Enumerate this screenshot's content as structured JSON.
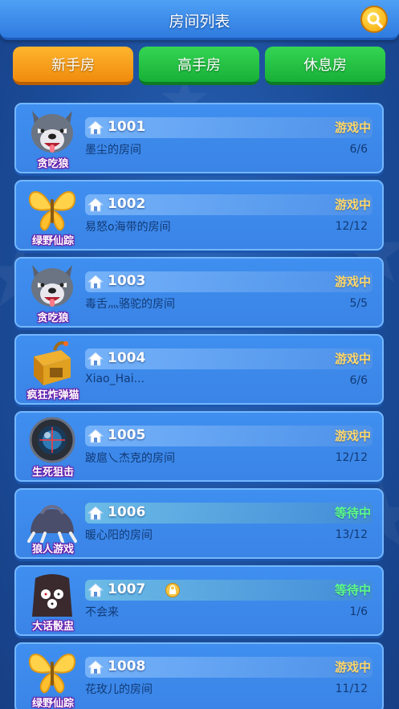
{
  "header": {
    "title": "房间列表"
  },
  "tabs": [
    {
      "label": "新手房",
      "active": true
    },
    {
      "label": "高手房",
      "active": false
    },
    {
      "label": "休息房",
      "active": false
    }
  ],
  "colors": {
    "playing": "#ffd86b",
    "waiting": "#5dfc8a",
    "accent": "#f08b0c"
  },
  "rooms": [
    {
      "id": "1001",
      "game": "贪吃狼",
      "icon": "wolf-icon",
      "name": "墨尘的房间",
      "status": "游戏中",
      "state": "playing",
      "count": "6/6",
      "locked": false
    },
    {
      "id": "1002",
      "game": "绿野仙踪",
      "icon": "butterfly-icon",
      "name": "易怒o海带的房间",
      "status": "游戏中",
      "state": "playing",
      "count": "12/12",
      "locked": false
    },
    {
      "id": "1003",
      "game": "贪吃狼",
      "icon": "wolf-icon",
      "name": "毒舌灬骆驼的房间",
      "status": "游戏中",
      "state": "playing",
      "count": "5/5",
      "locked": false
    },
    {
      "id": "1004",
      "game": "疯狂炸弹猫",
      "icon": "bomb-crate-icon",
      "name": "Xiao_Hai...",
      "status": "游戏中",
      "state": "playing",
      "count": "6/6",
      "locked": false
    },
    {
      "id": "1005",
      "game": "生死狙击",
      "icon": "scope-icon",
      "name": "跛扈乀杰克的房间",
      "status": "游戏中",
      "state": "playing",
      "count": "12/12",
      "locked": false
    },
    {
      "id": "1006",
      "game": "狼人游戏",
      "icon": "wolf-claw-icon",
      "name": "暖心阳的房间",
      "status": "等待中",
      "state": "waiting",
      "count": "13/12",
      "locked": false
    },
    {
      "id": "1007",
      "game": "大话骰盅",
      "icon": "dice-cup-icon",
      "name": "不会来",
      "status": "等待中",
      "state": "waiting",
      "count": "1/6",
      "locked": true
    },
    {
      "id": "1008",
      "game": "绿野仙踪",
      "icon": "butterfly-icon",
      "name": "花玫儿的房间",
      "status": "游戏中",
      "state": "playing",
      "count": "11/12",
      "locked": false
    }
  ]
}
